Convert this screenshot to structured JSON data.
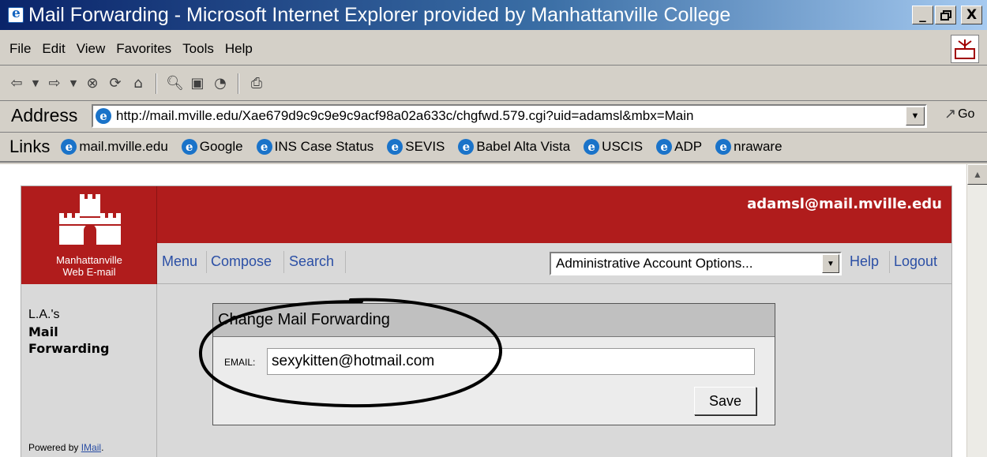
{
  "window": {
    "title": "Mail Forwarding - Microsoft Internet Explorer provided by Manhattanville College",
    "minimize": "_",
    "maximize": " ",
    "close": "X"
  },
  "menubar": [
    "File",
    "Edit",
    "View",
    "Favorites",
    "Tools",
    "Help"
  ],
  "address": {
    "label": "Address",
    "url": "http://mail.mville.edu/Xae679d9c9c9e9c9acf98a02a633c/chgfwd.579.cgi?uid=adamsl&mbx=Main",
    "go": "Go"
  },
  "links": {
    "label": "Links",
    "items": [
      "mail.mville.edu",
      "Google",
      "INS Case Status",
      "SEVIS",
      "Babel Alta Vista",
      "USCIS",
      "ADP",
      "nraware"
    ]
  },
  "app": {
    "user_email": "adamsl@mail.mville.edu",
    "logo_caption_line1": "Manhattanville",
    "logo_caption_line2": "Web E-mail",
    "nav": {
      "menu": "Menu",
      "compose": "Compose",
      "search": "Search",
      "admin_select": "Administrative Account Options...",
      "help": "Help",
      "logout": "Logout"
    },
    "sidebar": {
      "owner": "L.A.'s",
      "title_line1": "Mail",
      "title_line2": "Forwarding",
      "powered_by": "Powered by",
      "powered_link": "IMail"
    },
    "form": {
      "header": "Change Mail Forwarding",
      "email_label": "EMAIL:",
      "email_value": "sexykitten@hotmail.com",
      "save_label": "Save"
    }
  },
  "colors": {
    "brand_red": "#b01c1c",
    "nav_link": "#2b4fa5",
    "panel_gray": "#d9d9d9",
    "titlebar": "#0a246a"
  }
}
